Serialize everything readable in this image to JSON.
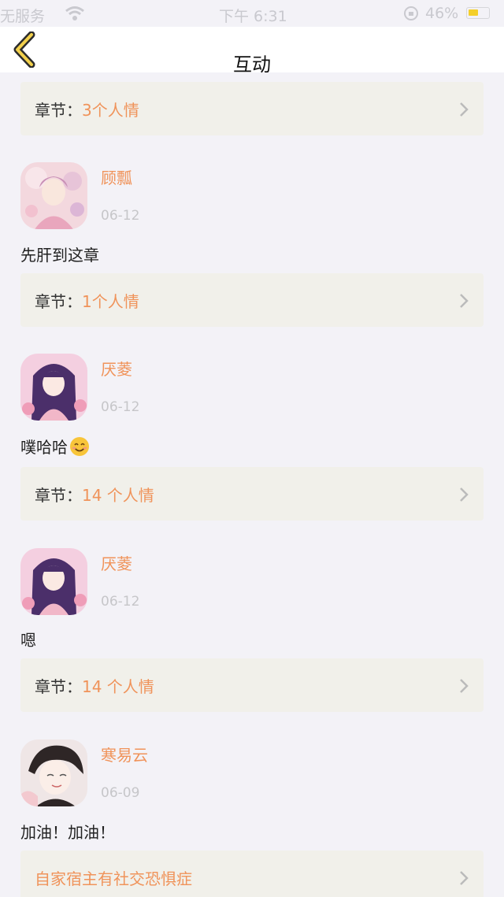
{
  "status_bar": {
    "carrier": "无服务",
    "time": "下午 6:31",
    "battery": "46%"
  },
  "nav": {
    "title": "互动"
  },
  "colors": {
    "accent": "#f0935a",
    "card_bg": "#f1f0ea",
    "page_bg": "#f3f2f7"
  },
  "chapter_prefix": "章节：",
  "top_card": {
    "value": "3个人情"
  },
  "comments": [
    {
      "name": "顾瓢",
      "date": "06-12",
      "text": "先肝到这章",
      "card_value": "1个人情"
    },
    {
      "name": "厌菱",
      "date": "06-12",
      "text": "噗哈哈",
      "card_value": "14 个人情",
      "emoji": "smiling-face"
    },
    {
      "name": "厌菱",
      "date": "06-12",
      "text": "嗯",
      "card_value": "14 个人情"
    },
    {
      "name": "寒易云",
      "date": "06-09",
      "text": "加油！加油！",
      "card_title": "自家宿主有社交恐惧症"
    }
  ]
}
